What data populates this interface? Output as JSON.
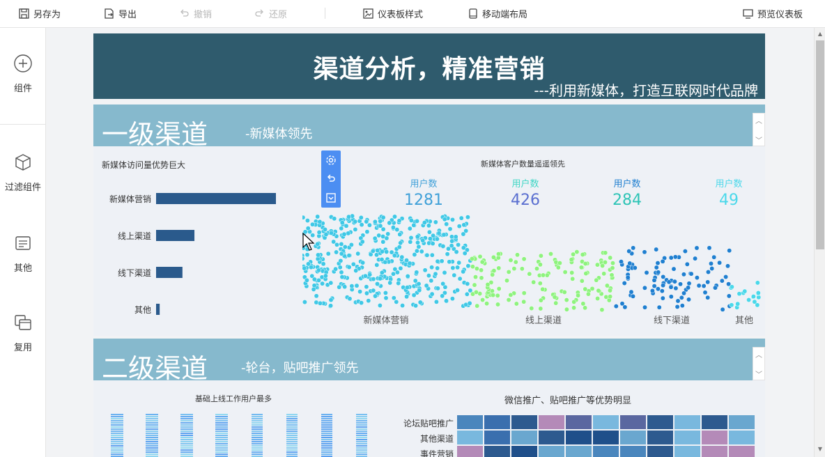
{
  "toolbar": {
    "save_as": "另存为",
    "export": "导出",
    "undo": "撤销",
    "redo": "还原",
    "dashboard_style": "仪表板样式",
    "mobile_layout": "移动端布局",
    "preview": "预览仪表板"
  },
  "sidebar": {
    "items": [
      {
        "label": "组件",
        "icon": "plus-circle-icon"
      },
      {
        "label": "过滤组件",
        "icon": "cube-icon"
      },
      {
        "label": "其他",
        "icon": "note-icon"
      },
      {
        "label": "复用",
        "icon": "copy-icon"
      }
    ]
  },
  "header": {
    "title": "渠道分析，精准营销",
    "subtitle": "---利用新媒体，打造互联网时代品牌"
  },
  "section1": {
    "title": "一级渠道",
    "subtitle": "-新媒体领先"
  },
  "section2": {
    "title": "二级渠道",
    "subtitle": "-轮台，贴吧推广领先"
  },
  "colors": {
    "header_bg": "#2f5b6d",
    "section_bg": "#86b9cd",
    "bar": "#2a5a8c",
    "accent_toolbar": "#4c8ef2"
  },
  "chart_data": [
    {
      "type": "bar",
      "title": "新媒体访问量优势巨大",
      "categories": [
        "新媒体营销",
        "线上渠道",
        "线下渠道",
        "其他"
      ],
      "values": [
        100,
        32,
        22,
        3
      ],
      "orientation": "horizontal"
    },
    {
      "type": "scatter",
      "title": "新媒体客户数量遥遥领先",
      "categories": [
        "新媒体营销",
        "线上渠道",
        "线下渠道",
        "其他"
      ],
      "kpi_label": "用户数",
      "values": [
        1281,
        426,
        284,
        49
      ],
      "colors": [
        "#3fc8e6",
        "#8ef37e",
        "#1f7fd0",
        "#4ad8ea"
      ]
    },
    {
      "type": "bar",
      "title": "基础上线工作用户最多",
      "series_count": 8
    },
    {
      "type": "heatmap",
      "title": "微信推广、贴吧推广等优势明显",
      "rows": [
        "论坛贴吧推广",
        "其他渠道",
        "事件营销"
      ]
    }
  ]
}
